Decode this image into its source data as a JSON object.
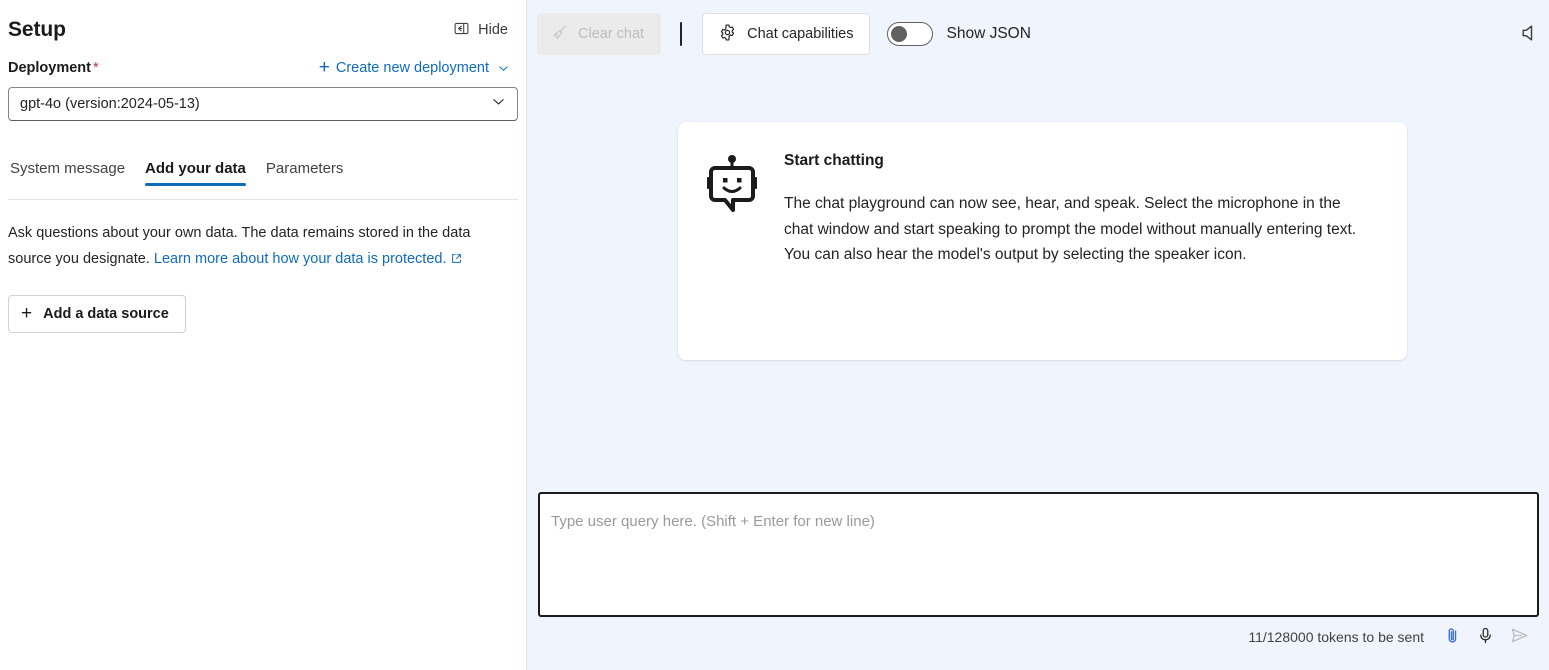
{
  "setup": {
    "title": "Setup",
    "hide_label": "Hide",
    "hide_icon": "panel-collapse-icon",
    "deployment_label": "Deployment",
    "required_mark": "*",
    "create_new_label": "Create new deployment",
    "create_new_icon": "plus-icon",
    "create_new_chevron": "chevron-down-icon",
    "deployment_value": "gpt-4o (version:2024-05-13)",
    "deployment_chevron": "chevron-down-icon",
    "tabs": [
      {
        "label": "System message",
        "active": false
      },
      {
        "label": "Add your data",
        "active": true
      },
      {
        "label": "Parameters",
        "active": false
      }
    ],
    "description_part1": "Ask questions about your own data. The data remains stored in the data source you designate. ",
    "description_link": "Learn more about how your data is protected.",
    "description_link_icon": "external-link-icon",
    "add_source_label": "Add a data source",
    "add_source_icon": "plus-icon"
  },
  "chat": {
    "toolbar": {
      "clear_chat_label": "Clear chat",
      "clear_chat_icon": "broom-icon",
      "clear_chat_disabled": true,
      "capabilities_label": "Chat capabilities",
      "capabilities_icon": "gear-icon",
      "show_json_label": "Show JSON",
      "show_json_on": false,
      "speaker_icon": "speaker-icon"
    },
    "start_card": {
      "icon": "bot-icon",
      "title": "Start chatting",
      "body": "The chat playground can now see, hear, and speak. Select the microphone in the chat window and start speaking to prompt the model without manually entering text. You can also hear the model's output by selecting the speaker icon."
    },
    "input": {
      "value": "",
      "placeholder": "Type user query here. (Shift + Enter for new line)",
      "token_count": "11/128000 tokens to be sent",
      "attach_icon": "paperclip-icon",
      "mic_icon": "microphone-icon",
      "send_icon": "send-icon"
    }
  },
  "colors": {
    "accent": "#0f6cbd",
    "required": "#c4314b",
    "chat_background": "#f0f4fc",
    "text_primary": "#242424",
    "attach_icon": "#3b6fd4",
    "disabled": "#bdbdbd"
  }
}
